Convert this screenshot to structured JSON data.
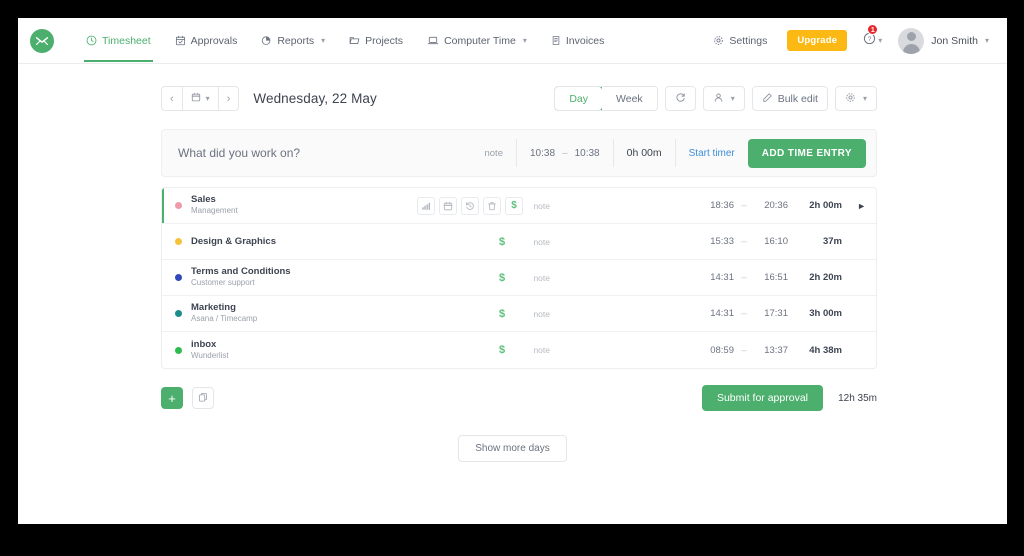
{
  "nav": {
    "logo_icon": "timecamp-logo-icon",
    "items": [
      {
        "label": "Timesheet",
        "icon": "clock-icon",
        "active": true,
        "caret": false
      },
      {
        "label": "Approvals",
        "icon": "calendar-check-icon",
        "active": false,
        "caret": false
      },
      {
        "label": "Reports",
        "icon": "pie-chart-icon",
        "active": false,
        "caret": true
      },
      {
        "label": "Projects",
        "icon": "folder-icon",
        "active": false,
        "caret": false
      },
      {
        "label": "Computer Time",
        "icon": "laptop-icon",
        "active": false,
        "caret": true
      },
      {
        "label": "Invoices",
        "icon": "invoice-icon",
        "active": false,
        "caret": false
      }
    ],
    "settings_label": "Settings",
    "settings_icon": "gear-icon",
    "upgrade_label": "Upgrade",
    "help_icon": "help-circle-icon",
    "help_badge": "1",
    "username": "Jon Smith"
  },
  "toolbar": {
    "prev_icon": "chevron-left-icon",
    "calendar_icon": "calendar-icon",
    "next_icon": "chevron-right-icon",
    "date_title": "Wednesday, 22 May",
    "day_label": "Day",
    "week_label": "Week",
    "refresh_icon": "refresh-icon",
    "person_icon": "person-icon",
    "bulk_edit_label": "Bulk edit",
    "bulk_edit_icon": "edit-icon",
    "settings_icon": "gear-icon"
  },
  "timer": {
    "placeholder": "What did you work on?",
    "note_label": "note",
    "start_time": "10:38",
    "dash": "–",
    "end_time": "10:38",
    "duration": "0h 00m",
    "start_timer_label": "Start timer",
    "add_entry_label": "ADD TIME ENTRY"
  },
  "entries": [
    {
      "dot_color": "#ef9aa8",
      "name": "Sales",
      "sub": "Management",
      "active": true,
      "icons": [
        "bar-chart-icon",
        "calendar-icon",
        "history-icon",
        "trash-icon",
        "dollar-icon"
      ],
      "note": "note",
      "start": "18:36",
      "dash": "–",
      "end": "20:36",
      "duration": "2h 00m",
      "play_icon": "play-icon"
    },
    {
      "dot_color": "#f5c33b",
      "name": "Design & Graphics",
      "sub": "",
      "active": false,
      "icons": [
        "dollar-icon"
      ],
      "note": "note",
      "start": "15:33",
      "dash": "–",
      "end": "16:10",
      "duration": "37m",
      "play_icon": ""
    },
    {
      "dot_color": "#2f49b8",
      "name": "Terms and Conditions",
      "sub": "Customer support",
      "active": false,
      "icons": [
        "dollar-icon"
      ],
      "note": "note",
      "start": "14:31",
      "dash": "–",
      "end": "16:51",
      "duration": "2h 20m",
      "play_icon": ""
    },
    {
      "dot_color": "#1e8b8b",
      "name": "Marketing",
      "sub": "Asana / Timecamp",
      "active": false,
      "icons": [
        "dollar-icon"
      ],
      "note": "note",
      "start": "14:31",
      "dash": "–",
      "end": "17:31",
      "duration": "3h 00m",
      "play_icon": ""
    },
    {
      "dot_color": "#2fbb4f",
      "name": "inbox",
      "sub": "Wunderlist",
      "active": false,
      "icons": [
        "dollar-icon"
      ],
      "note": "note",
      "start": "08:59",
      "dash": "–",
      "end": "13:37",
      "duration": "4h 38m",
      "play_icon": ""
    }
  ],
  "footer": {
    "add_icon": "plus-icon",
    "duplicate_icon": "copy-icon",
    "submit_label": "Submit for approval",
    "total": "12h 35m",
    "show_more_label": "Show more days"
  },
  "colors": {
    "brand_green": "#4caf6d",
    "upgrade_yellow": "#fdb913",
    "link_blue": "#3d8ed9",
    "badge_red": "#e8272c"
  }
}
